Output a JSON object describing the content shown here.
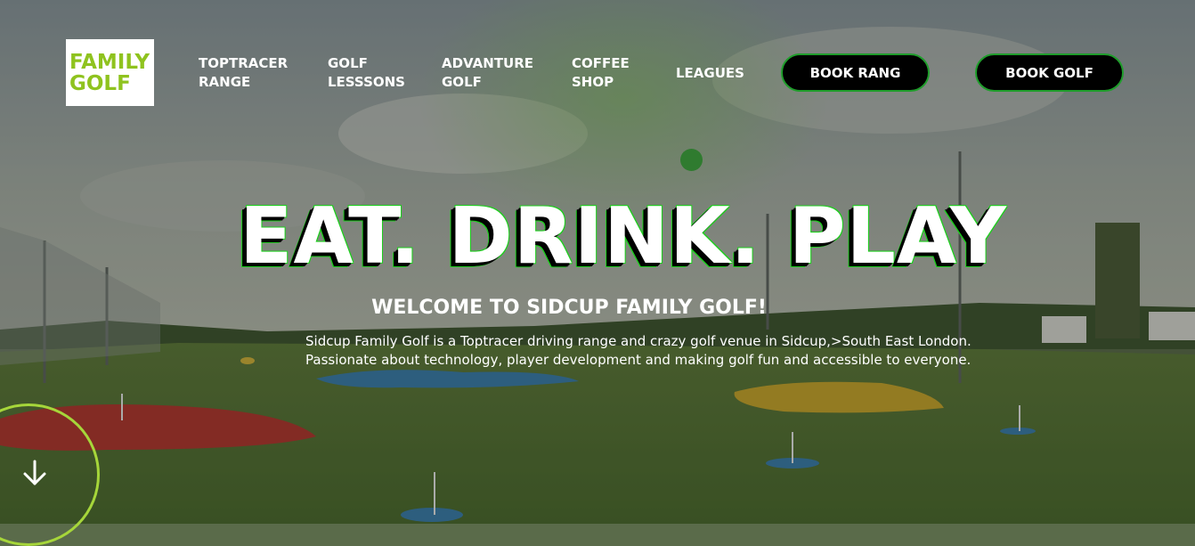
{
  "logo": {
    "line1": "FAMILY",
    "line2": "GOLF"
  },
  "nav": {
    "items": [
      {
        "line1": "TOPTRACER",
        "line2": "RANGE"
      },
      {
        "line1": "GOLF",
        "line2": "LESSSONS"
      },
      {
        "line1": "ADVANTURE",
        "line2": "GOLF"
      },
      {
        "line1": "COFFEE",
        "line2": "SHOP"
      },
      {
        "line1": "LEAGUES",
        "line2": ""
      }
    ],
    "book_range": "BOOK RANG",
    "book_golf": "BOOK GOLF"
  },
  "hero": {
    "headline": "EAT. DRINK. PLAY",
    "subheading": "WELCOME TO SIDCUP FAMILY GOLF!",
    "intro_line1": "Sidcup Family Golf is a Toptracer driving range and crazy golf venue in Sidcup,>South East London.",
    "intro_line2": "Passionate about technology, player development and making golf fun and accessible to everyone."
  },
  "icons": {
    "scroll": "arrow-down-icon"
  },
  "colors": {
    "brand_green": "#8fc31f",
    "button_border": "#1f9d2b",
    "headline_outline": "#1ccf1c",
    "scroll_ring": "#a6d63a"
  }
}
